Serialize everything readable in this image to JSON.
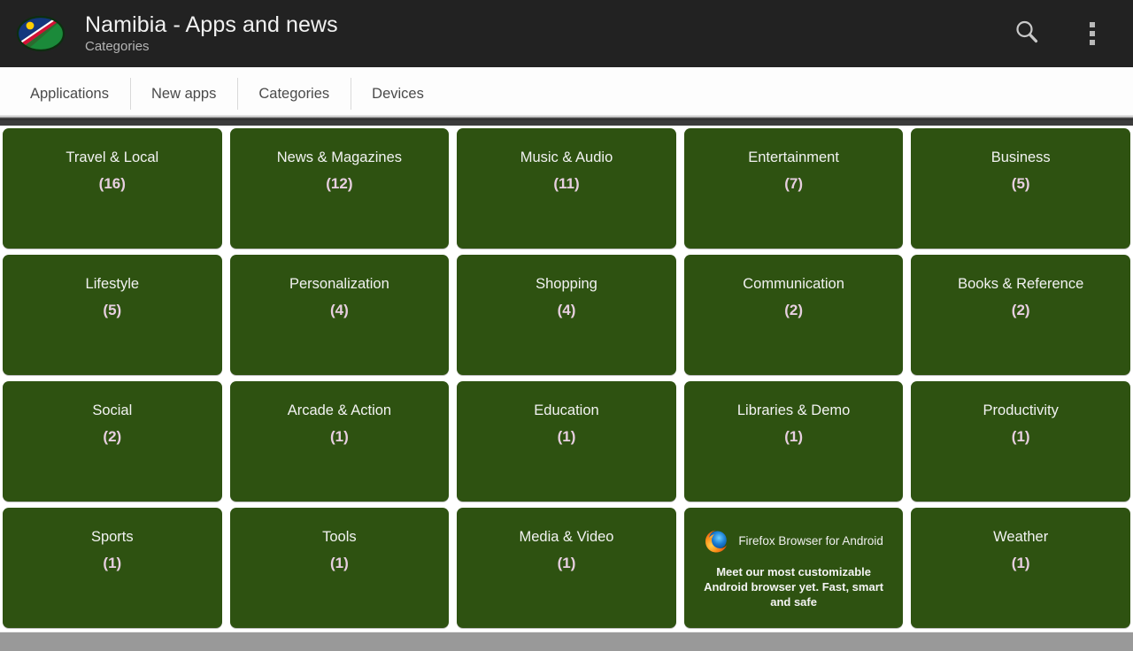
{
  "header": {
    "title": "Namibia - Apps and news",
    "subtitle": "Categories",
    "icon_name": "namibia-flag-oval-icon",
    "search_icon": "search-icon",
    "overflow_icon": "overflow-menu-icon",
    "background_color": "#222222"
  },
  "tabs": [
    {
      "label": "Applications",
      "selected": false
    },
    {
      "label": "New apps",
      "selected": false
    },
    {
      "label": "Categories",
      "selected": true
    },
    {
      "label": "Devices",
      "selected": false
    }
  ],
  "theme": {
    "card_color": "#2e5211",
    "card_title_color": "#f2f2f2",
    "card_count_color": "#e7cfe0",
    "page_background": "#ffffff",
    "bottom_bar_color": "#999999"
  },
  "categories": [
    {
      "name": "Travel & Local",
      "count": "(16)"
    },
    {
      "name": "News & Magazines",
      "count": "(12)"
    },
    {
      "name": "Music & Audio",
      "count": "(11)"
    },
    {
      "name": "Entertainment",
      "count": "(7)"
    },
    {
      "name": "Business",
      "count": "(5)"
    },
    {
      "name": "Lifestyle",
      "count": "(5)"
    },
    {
      "name": "Personalization",
      "count": "(4)"
    },
    {
      "name": "Shopping",
      "count": "(4)"
    },
    {
      "name": "Communication",
      "count": "(2)"
    },
    {
      "name": "Books & Reference",
      "count": "(2)"
    },
    {
      "name": "Social",
      "count": "(2)"
    },
    {
      "name": "Arcade & Action",
      "count": "(1)"
    },
    {
      "name": "Education",
      "count": "(1)"
    },
    {
      "name": "Libraries & Demo",
      "count": "(1)"
    },
    {
      "name": "Productivity",
      "count": "(1)"
    },
    {
      "name": "Sports",
      "count": "(1)"
    },
    {
      "name": "Tools",
      "count": "(1)"
    },
    {
      "name": "Media & Video",
      "count": "(1)"
    }
  ],
  "ad": {
    "position_index": 18,
    "logo_name": "firefox-logo-icon",
    "title": "Firefox Browser for Android",
    "description": "Meet our most customizable Android browser yet. Fast, smart and safe"
  },
  "last_category": {
    "name": "Weather",
    "count": "(1)"
  }
}
